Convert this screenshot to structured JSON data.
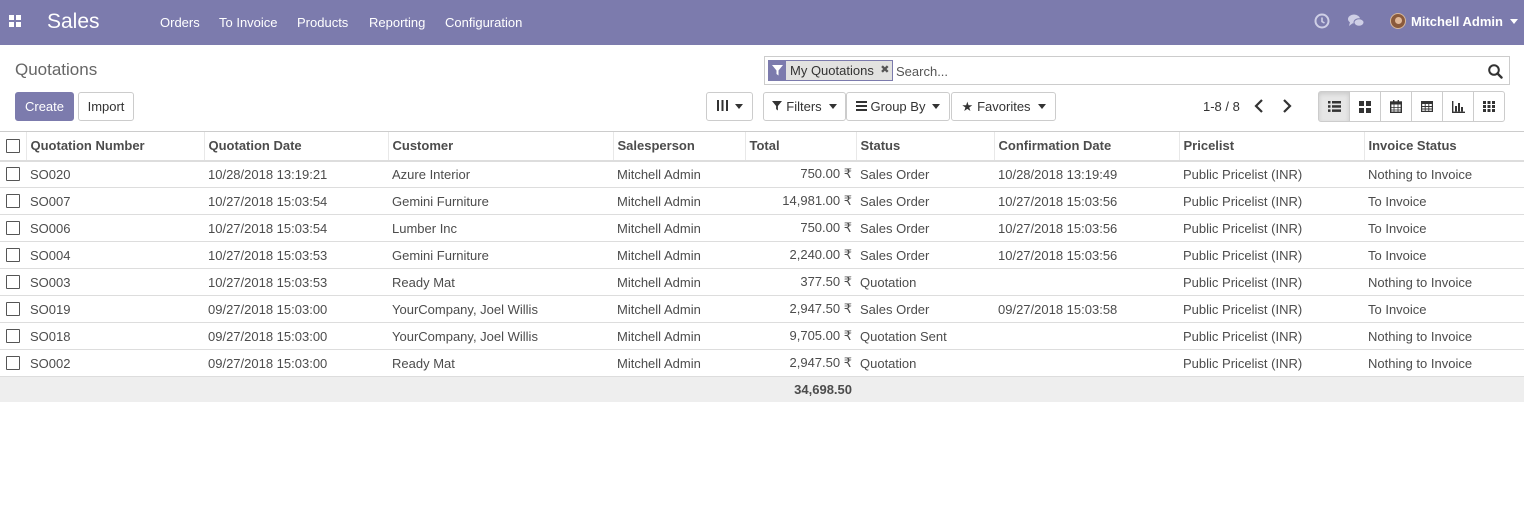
{
  "navbar": {
    "brand": "Sales",
    "menu": [
      "Orders",
      "To Invoice",
      "Products",
      "Reporting",
      "Configuration"
    ],
    "user_name": "Mitchell Admin",
    "bg_color": "#7c7bad",
    "icons": [
      "apps-icon",
      "clock-icon",
      "chat-icon"
    ]
  },
  "control_panel": {
    "breadcrumb": "Quotations",
    "create_label": "Create",
    "import_label": "Import",
    "search": {
      "facet_label": "My Quotations",
      "placeholder": "Search..."
    },
    "filters_label": "Filters",
    "group_by_label": "Group By",
    "favorites_label": "Favorites",
    "pager": "1-8 / 8",
    "views": [
      "list-view",
      "kanban-view",
      "calendar-view",
      "pivot-view",
      "graph-view",
      "activity-view"
    ],
    "active_view": "list-view"
  },
  "table": {
    "columns": [
      "Quotation Number",
      "Quotation Date",
      "Customer",
      "Salesperson",
      "Total",
      "Status",
      "Confirmation Date",
      "Pricelist",
      "Invoice Status"
    ],
    "rows": [
      {
        "number": "SO020",
        "date": "10/28/2018 13:19:21",
        "customer": "Azure Interior",
        "salesperson": "Mitchell Admin",
        "total": "750.00 ₹",
        "status": "Sales Order",
        "confirmation": "10/28/2018 13:19:49",
        "pricelist": "Public Pricelist (INR)",
        "invoice": "Nothing to Invoice"
      },
      {
        "number": "SO007",
        "date": "10/27/2018 15:03:54",
        "customer": "Gemini Furniture",
        "salesperson": "Mitchell Admin",
        "total": "14,981.00 ₹",
        "status": "Sales Order",
        "confirmation": "10/27/2018 15:03:56",
        "pricelist": "Public Pricelist (INR)",
        "invoice": "To Invoice"
      },
      {
        "number": "SO006",
        "date": "10/27/2018 15:03:54",
        "customer": "Lumber Inc",
        "salesperson": "Mitchell Admin",
        "total": "750.00 ₹",
        "status": "Sales Order",
        "confirmation": "10/27/2018 15:03:56",
        "pricelist": "Public Pricelist (INR)",
        "invoice": "To Invoice"
      },
      {
        "number": "SO004",
        "date": "10/27/2018 15:03:53",
        "customer": "Gemini Furniture",
        "salesperson": "Mitchell Admin",
        "total": "2,240.00 ₹",
        "status": "Sales Order",
        "confirmation": "10/27/2018 15:03:56",
        "pricelist": "Public Pricelist (INR)",
        "invoice": "To Invoice"
      },
      {
        "number": "SO003",
        "date": "10/27/2018 15:03:53",
        "customer": "Ready Mat",
        "salesperson": "Mitchell Admin",
        "total": "377.50 ₹",
        "status": "Quotation",
        "confirmation": "",
        "pricelist": "Public Pricelist (INR)",
        "invoice": "Nothing to Invoice"
      },
      {
        "number": "SO019",
        "date": "09/27/2018 15:03:00",
        "customer": "YourCompany, Joel Willis",
        "salesperson": "Mitchell Admin",
        "total": "2,947.50 ₹",
        "status": "Sales Order",
        "confirmation": "09/27/2018 15:03:58",
        "pricelist": "Public Pricelist (INR)",
        "invoice": "To Invoice"
      },
      {
        "number": "SO018",
        "date": "09/27/2018 15:03:00",
        "customer": "YourCompany, Joel Willis",
        "salesperson": "Mitchell Admin",
        "total": "9,705.00 ₹",
        "status": "Quotation Sent",
        "confirmation": "",
        "pricelist": "Public Pricelist (INR)",
        "invoice": "Nothing to Invoice"
      },
      {
        "number": "SO002",
        "date": "09/27/2018 15:03:00",
        "customer": "Ready Mat",
        "salesperson": "Mitchell Admin",
        "total": "2,947.50 ₹",
        "status": "Quotation",
        "confirmation": "",
        "pricelist": "Public Pricelist (INR)",
        "invoice": "Nothing to Invoice"
      }
    ],
    "total_sum": "34,698.50"
  }
}
